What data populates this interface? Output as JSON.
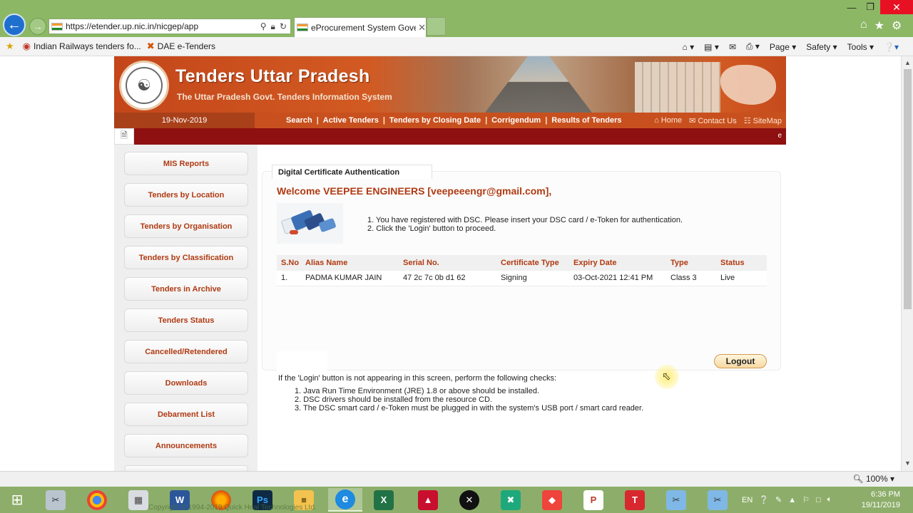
{
  "browser": {
    "url": "https://etender.up.nic.in/nicgep/app",
    "tab_title": "eProcurement System Gove...",
    "favorites": [
      "Indian Railways tenders fo...",
      "DAE e-Tenders"
    ],
    "commands": [
      "Page ▾",
      "Safety ▾",
      "Tools ▾"
    ],
    "zoom": "100%"
  },
  "site": {
    "title": "Tenders Uttar Pradesh",
    "subtitle": "The Uttar Pradesh Govt. Tenders Information System",
    "date": "19-Nov-2019",
    "nav": [
      "Search",
      "Active Tenders",
      "Tenders by Closing Date",
      "Corrigendum",
      "Results of Tenders"
    ],
    "right_links": [
      "Home",
      "Contact Us",
      "SiteMap"
    ],
    "ticker_text": "e"
  },
  "sidebar": {
    "items": [
      "MIS Reports",
      "Tenders by Location",
      "Tenders by Organisation",
      "Tenders by Classification",
      "Tenders in Archive",
      "Tenders Status",
      "Cancelled/Retendered",
      "Downloads",
      "Debarment List",
      "Announcements"
    ]
  },
  "auth": {
    "tab_title": "Digital Certificate Authentication",
    "welcome": "Welcome VEEPEE ENGINEERS [veepeeengr@gmail.com],",
    "instructions": [
      "1.  You have registered with DSC. Please insert your DSC card / e-Token for authentication.",
      "2.  Click the 'Login' button to proceed."
    ],
    "table": {
      "headers": [
        "S.No",
        "Alias Name",
        "Serial No.",
        "Certificate Type",
        "Expiry Date",
        "Type",
        "Status"
      ],
      "rows": [
        [
          "1.",
          "PADMA KUMAR JAIN",
          "47 2c 7c 0b d1 62",
          "Signing",
          "03-Oct-2021 12:41 PM",
          "Class 3",
          "Live"
        ]
      ]
    },
    "logout_label": "Logout",
    "checks_intro": "If the 'Login' button is not appearing in this screen, perform the following checks:",
    "checks": [
      "1.  Java Run Time Environment (JRE) 1.8 or above should be installed.",
      "2.  DSC drivers should be installed from the resource CD.",
      "3.  The DSC smart card / e-Token must be plugged in with the system's USB port / smart card reader."
    ]
  },
  "taskbar": {
    "language": "EN",
    "time": "6:36 PM",
    "date": "19/11/2019",
    "copyright": "Copyright © 1994-2019 Quick Heal Technologies Ltd."
  },
  "colors": {
    "header_orange": "#c8501e",
    "accent_text": "#b03a12",
    "ticker_red": "#8e1010"
  },
  "icons": {
    "back": "back-arrow-icon",
    "forward": "forward-arrow-icon",
    "home": "home-icon",
    "favorites": "star-icon",
    "settings": "gear-icon"
  }
}
